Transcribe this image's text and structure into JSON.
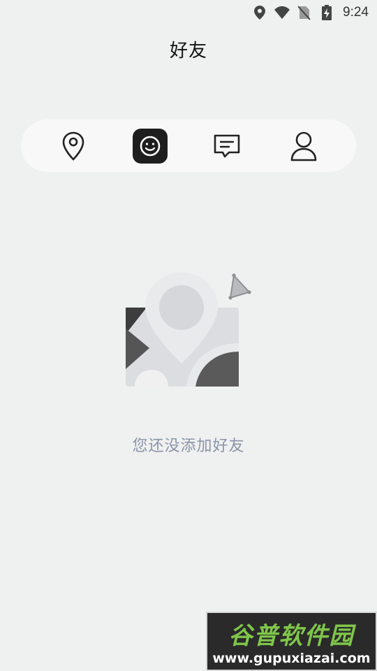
{
  "status_bar": {
    "time": "9:24",
    "icons": [
      "location-icon",
      "wifi-icon",
      "no-sim-icon",
      "battery-charging-icon"
    ]
  },
  "header": {
    "title": "好友"
  },
  "tabs": [
    {
      "icon": "location-pin-icon",
      "active": false
    },
    {
      "icon": "smiley-icon",
      "active": true
    },
    {
      "icon": "message-icon",
      "active": false
    },
    {
      "icon": "profile-icon",
      "active": false
    }
  ],
  "empty_state": {
    "message": "您还没添加好友",
    "illustration": "map-pin-illustration"
  },
  "watermark": {
    "name": "谷普软件园",
    "url": "www.gupuxiazai.com"
  },
  "colors": {
    "background": "#eff0f0",
    "tab_bar": "#f8f8f8",
    "active_tab": "#1e1e1e",
    "empty_text": "#8a95a8"
  }
}
